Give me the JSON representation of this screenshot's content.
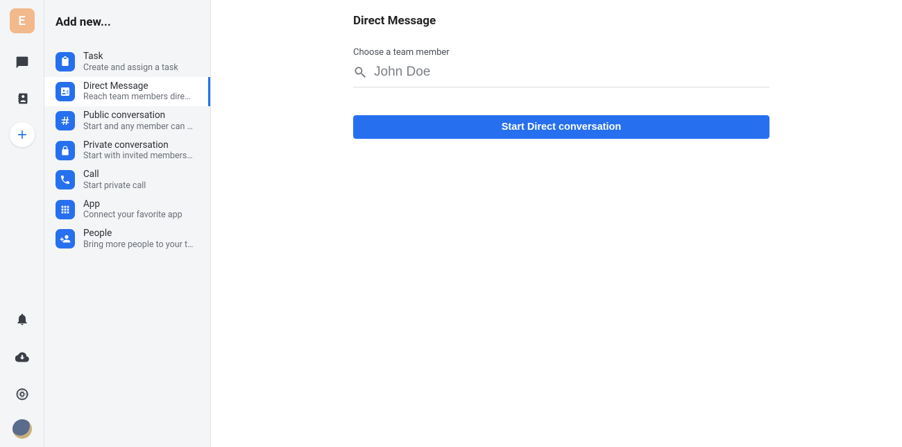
{
  "rail": {
    "avatar_letter": "E"
  },
  "panel": {
    "title": "Add new..."
  },
  "items": [
    {
      "title": "Task",
      "sub": "Create and assign a task"
    },
    {
      "title": "Direct Message",
      "sub": "Reach team members directly"
    },
    {
      "title": "Public conversation",
      "sub": "Start and any member can jo…"
    },
    {
      "title": "Private conversation",
      "sub": "Start with invited members o…"
    },
    {
      "title": "Call",
      "sub": "Start private call"
    },
    {
      "title": "App",
      "sub": "Connect your favorite app"
    },
    {
      "title": "People",
      "sub": "Bring more people to your te…"
    }
  ],
  "main": {
    "title": "Direct Message",
    "field_label": "Choose a team member",
    "search_placeholder": "John Doe",
    "primary_button": "Start Direct conversation"
  },
  "active_index": 1
}
